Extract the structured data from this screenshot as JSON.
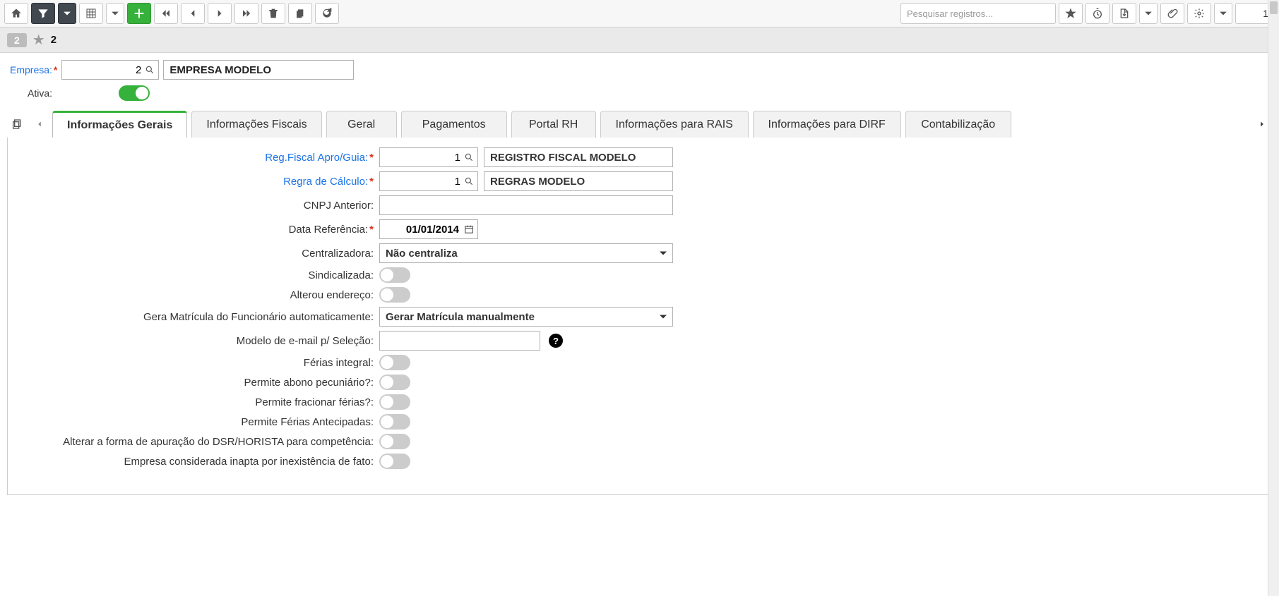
{
  "toolbar": {
    "search_placeholder": "Pesquisar registros...",
    "page_number": "1"
  },
  "record": {
    "badge": "2",
    "id": "2"
  },
  "header": {
    "empresa_label": "Empresa:",
    "empresa_code": "2",
    "empresa_name": "EMPRESA MODELO",
    "ativa_label": "Ativa:"
  },
  "tabs": [
    "Informações Gerais",
    "Informações Fiscais",
    "Geral",
    "Pagamentos",
    "Portal RH",
    "Informações para RAIS",
    "Informações para DIRF",
    "Contabilização"
  ],
  "details": {
    "reg_fiscal": {
      "label": "Reg.Fiscal Apro/Guia:",
      "code": "1",
      "desc": "REGISTRO FISCAL MODELO"
    },
    "regra_calc": {
      "label": "Regra de Cálculo:",
      "code": "1",
      "desc": "REGRAS MODELO"
    },
    "cnpj_anterior": {
      "label": "CNPJ Anterior:",
      "value": ""
    },
    "data_ref": {
      "label": "Data Referência:",
      "value": "01/01/2014"
    },
    "centralizadora": {
      "label": "Centralizadora:",
      "value": "Não centraliza"
    },
    "sindicalizada": {
      "label": "Sindicalizada:"
    },
    "alterou_endereco": {
      "label": "Alterou endereço:"
    },
    "gera_matricula": {
      "label": "Gera Matrícula do Funcionário automaticamente:",
      "value": "Gerar Matrícula manualmente"
    },
    "modelo_email": {
      "label": "Modelo de e-mail p/ Seleção:",
      "value": ""
    },
    "ferias_integral": {
      "label": "Férias integral:"
    },
    "permite_abono": {
      "label": "Permite abono pecuniário?:"
    },
    "permite_fracionar": {
      "label": "Permite fracionar férias?:"
    },
    "permite_antecipadas": {
      "label": "Permite Férias Antecipadas:"
    },
    "alterar_dsr": {
      "label": "Alterar a forma de apuração do DSR/HORISTA para competência:"
    },
    "empresa_inapta": {
      "label": "Empresa considerada inapta por inexistência de fato:"
    }
  }
}
